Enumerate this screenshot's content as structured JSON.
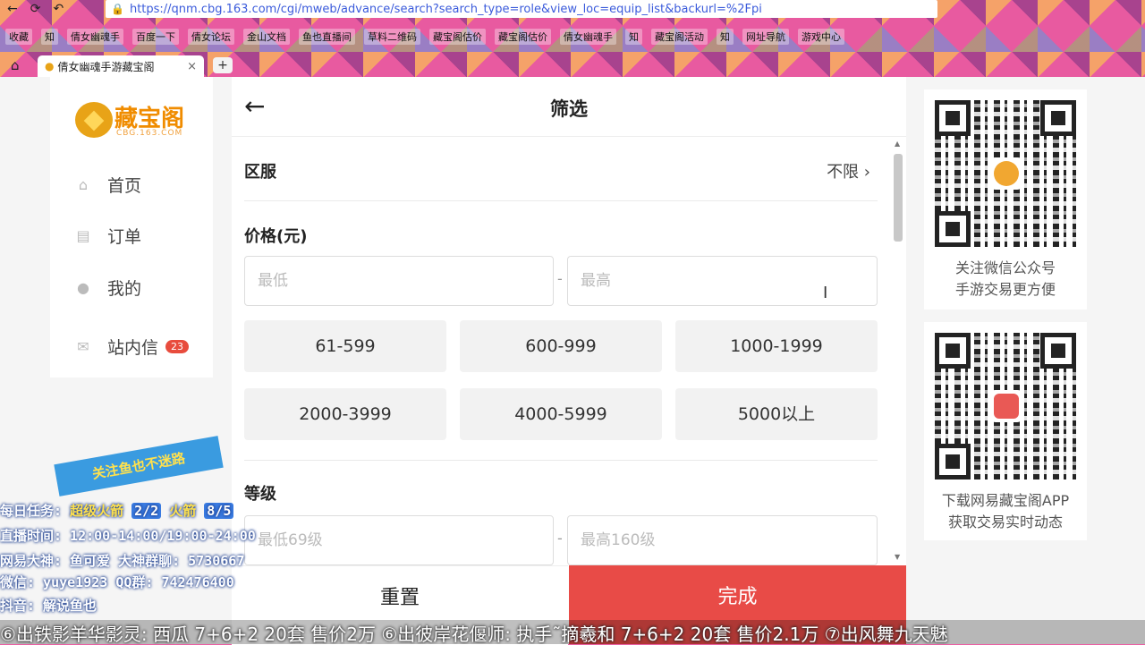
{
  "browser": {
    "url": "https://qnm.cbg.163.com/cgi/mweb/advance/search?search_type=role&view_loc=equip_list&backurl=%2Fpi",
    "bookmarks": [
      "收藏",
      "知",
      "倩女幽魂手",
      "百度一下",
      "倩女论坛",
      "金山文档",
      "鱼也直播间",
      "草料二维码",
      "藏宝阁估价",
      "藏宝阁估价",
      "倩女幽魂手",
      "知",
      "藏宝阁活动",
      "知",
      "网址导航",
      "游戏中心"
    ],
    "tab_title": "倩女幽魂手游藏宝阁",
    "tab_close": "×",
    "new_tab": "+"
  },
  "sidebar": {
    "logo_text": "藏宝阁",
    "logo_sub": "CBG.163.COM",
    "items": [
      {
        "label": "首页",
        "icon": "home-icon"
      },
      {
        "label": "订单",
        "icon": "order-icon"
      },
      {
        "label": "我的",
        "icon": "user-icon"
      },
      {
        "label": "站内信",
        "icon": "mail-icon",
        "badge": "23"
      }
    ]
  },
  "filter": {
    "title": "筛选",
    "region_label": "区服",
    "region_value": "不限",
    "price_label": "价格(元)",
    "price_min_placeholder": "最低",
    "price_max_placeholder": "最高",
    "price_ranges": [
      "61-599",
      "600-999",
      "1000-1999",
      "2000-3999",
      "4000-5999",
      "5000以上"
    ],
    "level_label": "等级",
    "level_min_placeholder": "最低69级",
    "level_max_placeholder": "最高160级",
    "reset_label": "重置",
    "done_label": "完成"
  },
  "qr_panels": [
    {
      "caption_1": "关注微信公众号",
      "caption_2": "手游交易更方便"
    },
    {
      "caption_1": "下载网易藏宝阁APP",
      "caption_2": "获取交易实时动态"
    }
  ],
  "stream_overlay": {
    "ribbon": "关注鱼也不迷路",
    "task_label": "每日任务:",
    "task_1": "超级火箭",
    "task_1_count": "2/2",
    "task_2": "火箭",
    "task_2_count": "8/5",
    "schedule": "直播时间: 12:00-14:00/19:00-24:00",
    "line_3": "网易大神: 鱼可爱 大神群聊: 5730667",
    "line_4": "微信: yuye1923 QQ群: 742476400",
    "line_5": "抖音: 解说鱼也"
  },
  "ticker": "⑥出铁影羊华影灵: 西瓜 7+6+2 20套 售价2万 ⑥出彼岸花偃师: 执手˜摘羲和 7+6+2 20套 售价2.1万 ⑦出风舞九天魅"
}
